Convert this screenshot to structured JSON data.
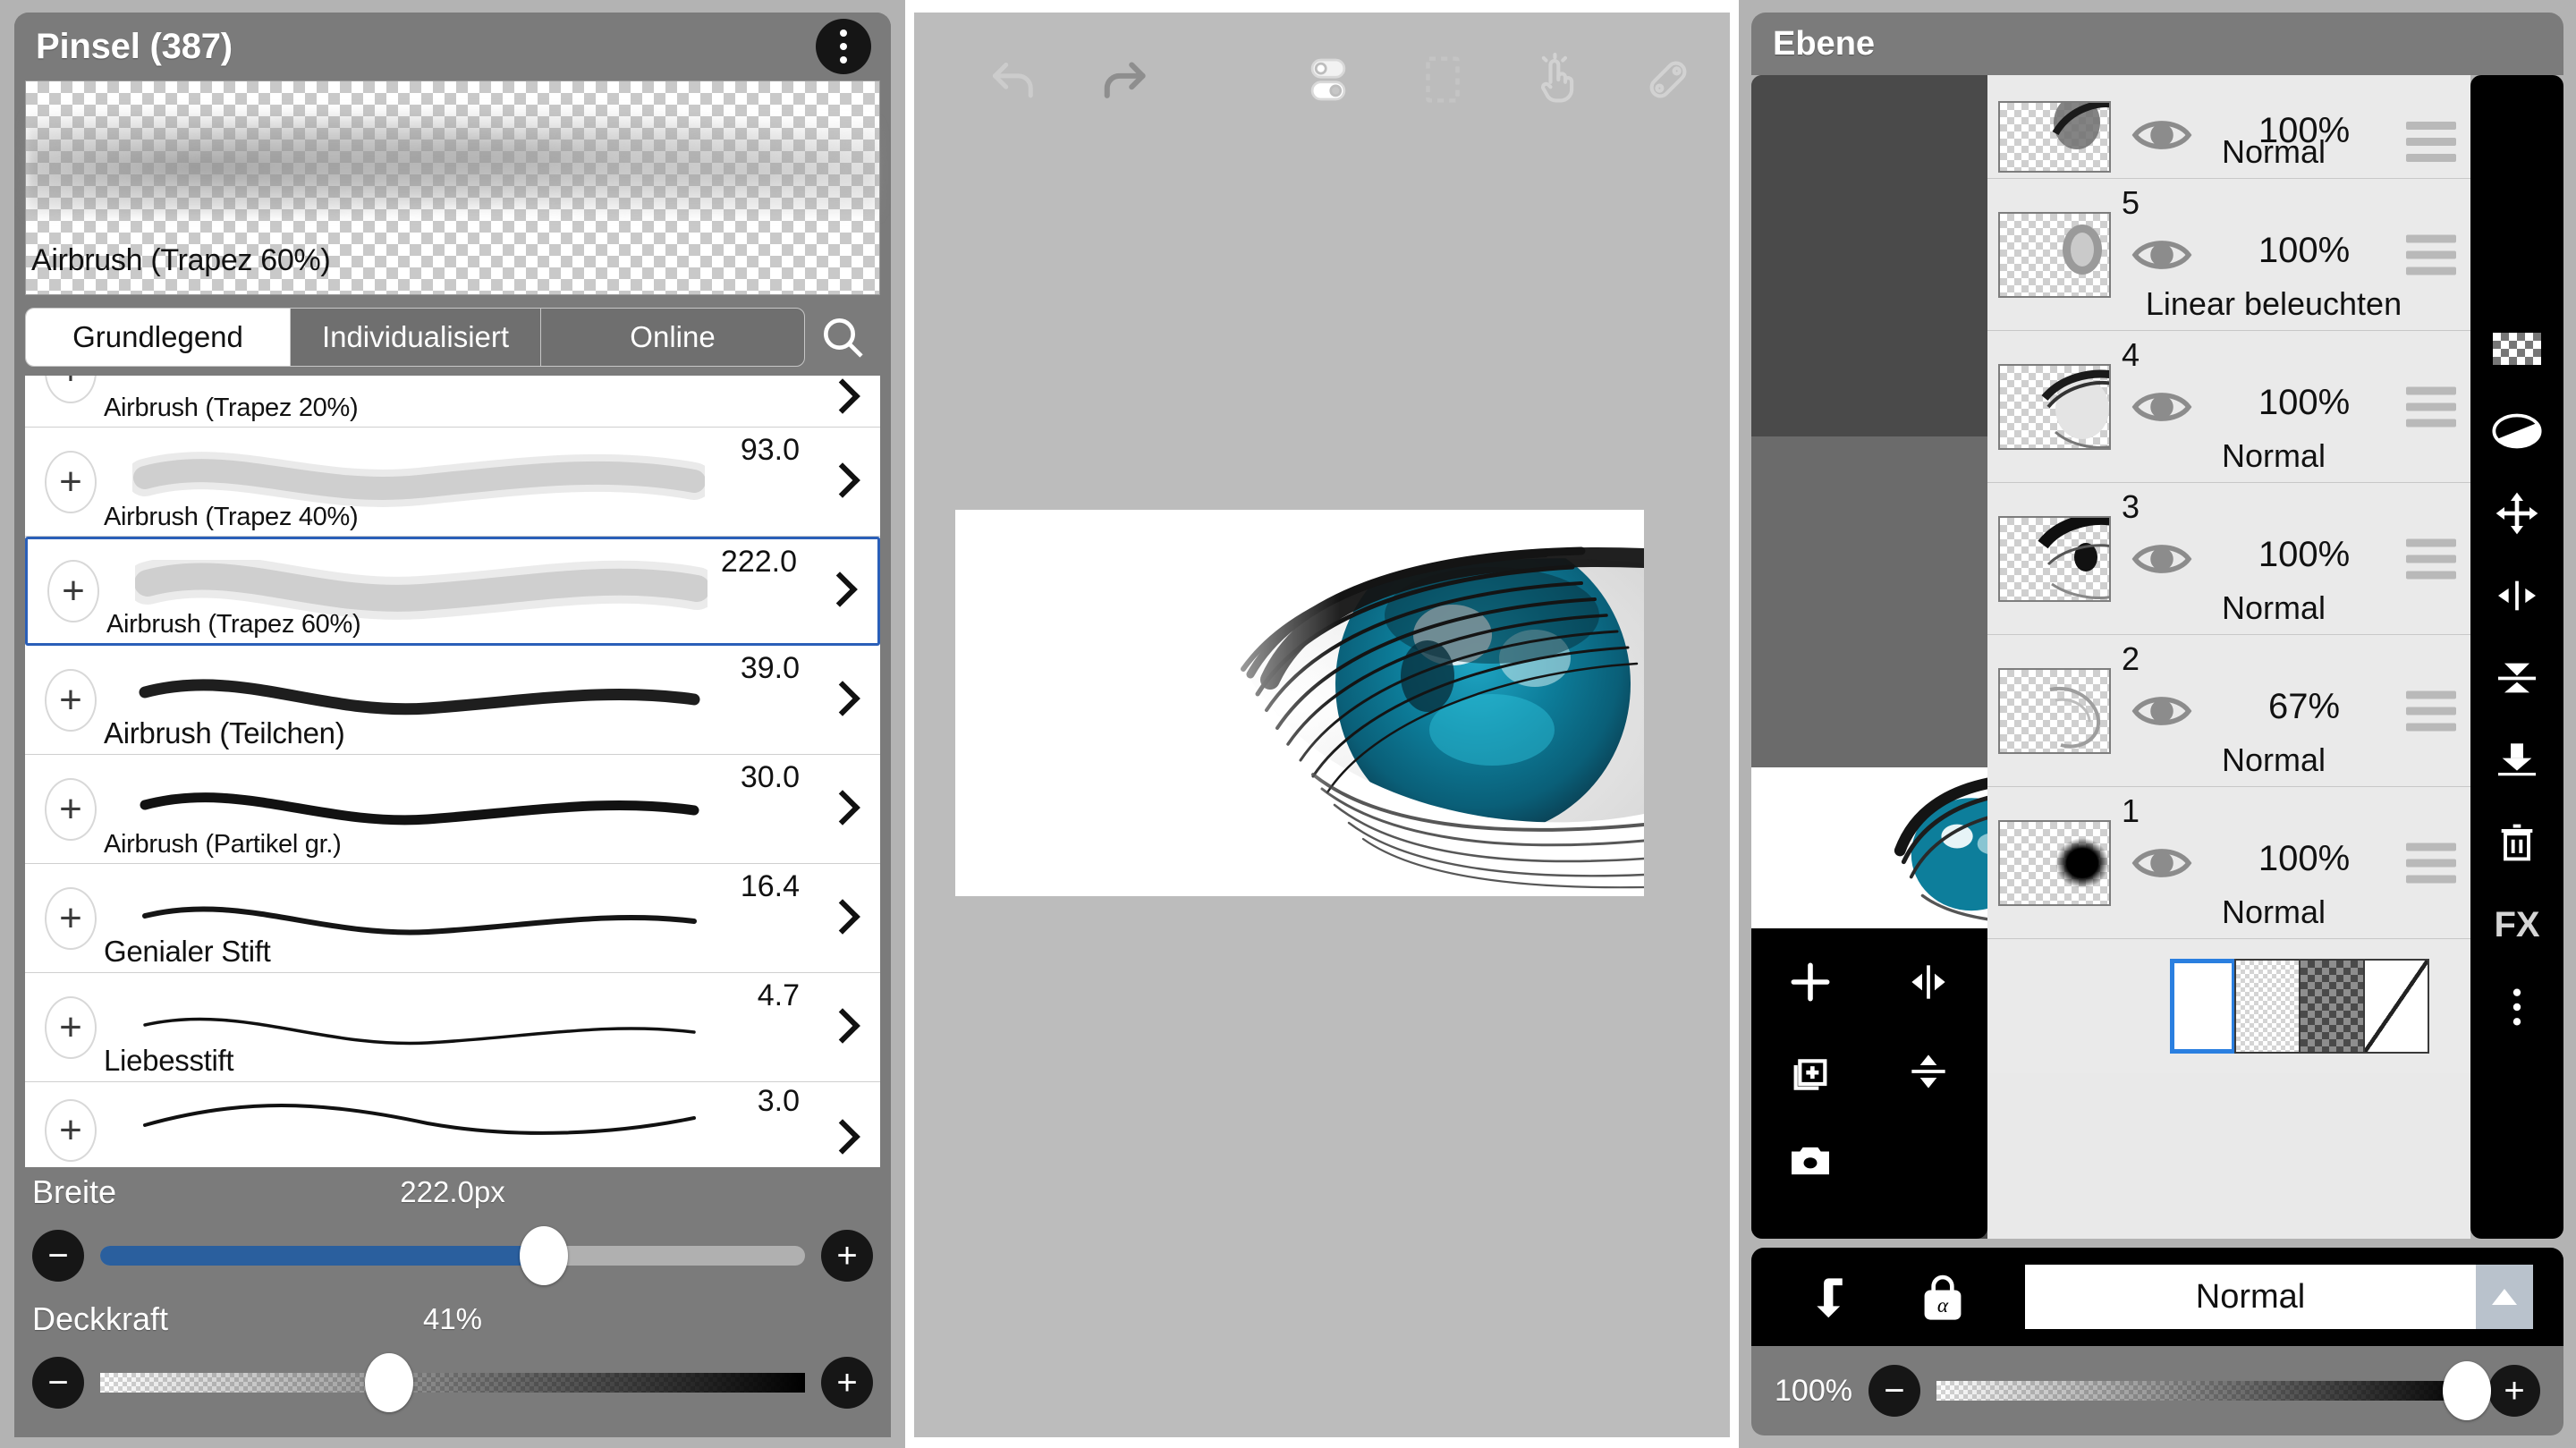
{
  "brush_panel": {
    "title": "Pinsel (387)",
    "menu_icon": "kebab-menu-icon",
    "preview_name": "Airbrush (Trapez 60%)",
    "tabs": [
      {
        "label": "Grundlegend",
        "active": true
      },
      {
        "label": "Individualisiert",
        "active": false
      },
      {
        "label": "Online",
        "active": false
      }
    ],
    "search_icon": "search-icon",
    "brushes": [
      {
        "name": "Airbrush (Trapez 20%)",
        "size": "",
        "selected": false,
        "partial": "top"
      },
      {
        "name": "Airbrush (Trapez 40%)",
        "size": "93.0",
        "selected": false
      },
      {
        "name": "Airbrush (Trapez 60%)",
        "size": "222.0",
        "selected": true
      },
      {
        "name": "Airbrush (Teilchen)",
        "size": "39.0",
        "selected": false
      },
      {
        "name": "Airbrush (Partikel gr.)",
        "size": "30.0",
        "selected": false
      },
      {
        "name": "Genialer Stift",
        "size": "16.4",
        "selected": false
      },
      {
        "name": "Liebesstift",
        "size": "4.7",
        "selected": false
      },
      {
        "name": "",
        "size": "3.0",
        "selected": false,
        "partial": "bottom"
      }
    ],
    "width_slider": {
      "label": "Breite",
      "value": "222.0px",
      "percent": 63,
      "minus": "−",
      "plus": "+"
    },
    "opacity_slider": {
      "label": "Deckkraft",
      "value": "41%",
      "percent": 41,
      "minus": "−",
      "plus": "+"
    }
  },
  "canvas_panel": {
    "toolbar": [
      {
        "name": "undo-icon",
        "enabled": false
      },
      {
        "name": "redo-icon",
        "enabled": true
      },
      {
        "name": "layer-toggle-icon",
        "enabled": true
      },
      {
        "name": "selection-marquee-icon",
        "enabled": false
      },
      {
        "name": "finger-gesture-icon",
        "enabled": true
      },
      {
        "name": "brush-pen-icon",
        "enabled": true
      },
      {
        "name": "image-import-icon",
        "enabled": true
      }
    ]
  },
  "layer_panel": {
    "title": "Ebene",
    "layers": [
      {
        "num": "",
        "opacity": "100%",
        "blend": "Normal",
        "visible": true,
        "cut": true
      },
      {
        "num": "5",
        "opacity": "100%",
        "blend": "Linear beleuchten",
        "visible": true
      },
      {
        "num": "4",
        "opacity": "100%",
        "blend": "Normal",
        "visible": true
      },
      {
        "num": "3",
        "opacity": "100%",
        "blend": "Normal",
        "visible": true
      },
      {
        "num": "2",
        "opacity": "67%",
        "blend": "Normal",
        "visible": true
      },
      {
        "num": "1",
        "opacity": "100%",
        "blend": "Normal",
        "visible": true
      }
    ],
    "background_swatches": [
      {
        "name": "bg-white-swatch",
        "kind": "white",
        "selected": true
      },
      {
        "name": "bg-transparent-light-swatch",
        "kind": "light",
        "selected": false
      },
      {
        "name": "bg-transparent-dark-swatch",
        "kind": "dark",
        "selected": false
      },
      {
        "name": "bg-diagonal-swatch",
        "kind": "diag",
        "selected": false
      }
    ],
    "mini_tools": [
      {
        "name": "add-layer-icon"
      },
      {
        "name": "flip-horizontal-icon"
      },
      {
        "name": "duplicate-layer-icon"
      },
      {
        "name": "flip-vertical-icon"
      },
      {
        "name": "camera-icon"
      }
    ],
    "side_tools": [
      {
        "name": "transparency-checker-icon"
      },
      {
        "name": "invert-icon"
      },
      {
        "name": "move-icon"
      },
      {
        "name": "mirror-horizontal-icon"
      },
      {
        "name": "merge-up-icon"
      },
      {
        "name": "merge-down-icon"
      },
      {
        "name": "delete-trash-icon"
      },
      {
        "name": "fx-icon",
        "label": "FX"
      },
      {
        "name": "more-vertical-icon"
      }
    ],
    "blend_bar": {
      "clipping_icon": "clipping-mask-icon",
      "alpha_lock_icon": "alpha-lock-icon",
      "alpha_lock_label": "α",
      "blend_mode": "Normal",
      "dropdown_icon": "chevron-up-icon"
    },
    "opacity_bar": {
      "value": "100%",
      "percent": 100,
      "minus": "−",
      "plus": "+"
    }
  },
  "colors": {
    "panel_bg": "#b3b3b3",
    "header_gray": "#7b7b7b",
    "accent_blue": "#2a5fb8",
    "slider_blue": "#2a5f9e",
    "canvas_bg": "#bcbcbc",
    "layer_list_bg": "#e9e9e9",
    "black_toolbar": "#000000",
    "iris_teal": "#0d7e9b"
  }
}
